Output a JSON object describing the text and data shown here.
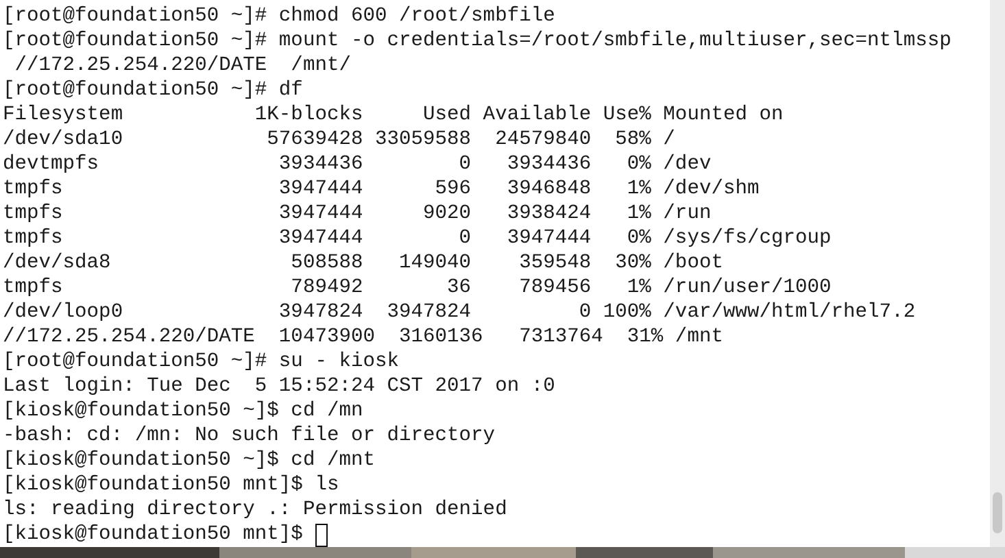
{
  "terminal": {
    "lines": [
      "[root@foundation50 ~]# chmod 600 /root/smbfile",
      "[root@foundation50 ~]# mount -o credentials=/root/smbfile,multiuser,sec=ntlmssp",
      " //172.25.254.220/DATE  /mnt/",
      "[root@foundation50 ~]# df",
      "Filesystem           1K-blocks     Used Available Use% Mounted on",
      "/dev/sda10            57639428 33059588  24579840  58% /",
      "devtmpfs               3934436        0   3934436   0% /dev",
      "tmpfs                  3947444      596   3946848   1% /dev/shm",
      "tmpfs                  3947444     9020   3938424   1% /run",
      "tmpfs                  3947444        0   3947444   0% /sys/fs/cgroup",
      "/dev/sda8               508588   149040    359548  30% /boot",
      "tmpfs                   789492       36    789456   1% /run/user/1000",
      "/dev/loop0             3947824  3947824         0 100% /var/www/html/rhel7.2",
      "//172.25.254.220/DATE  10473900  3160136   7313764  31% /mnt",
      "[root@foundation50 ~]# su - kiosk",
      "Last login: Tue Dec  5 15:52:24 CST 2017 on :0",
      "[kiosk@foundation50 ~]$ cd /mn",
      "-bash: cd: /mn: No such file or directory",
      "[kiosk@foundation50 ~]$ cd /mnt",
      "[kiosk@foundation50 mnt]$ ls",
      "ls: reading directory .: Permission denied"
    ],
    "prompt": "[kiosk@foundation50 mnt]$ "
  }
}
